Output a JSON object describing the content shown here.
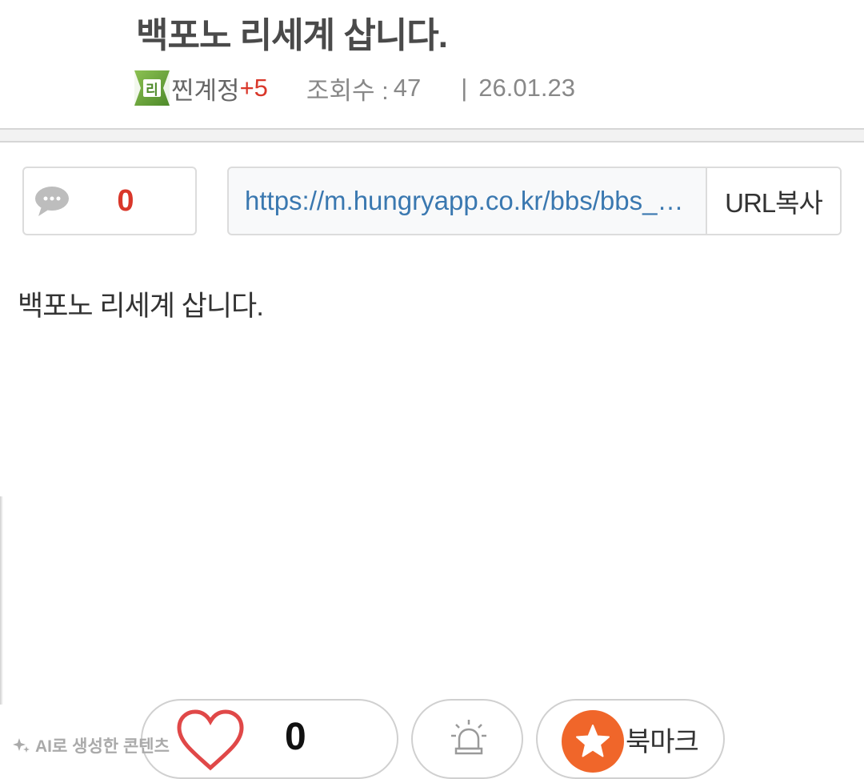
{
  "post": {
    "title": "백포노 리세계 삽니다.",
    "level_badge_text": "리",
    "author": "찐계정",
    "author_level": "+5",
    "views_label": "조회수 :",
    "views_value": "47",
    "date_separator": "|",
    "date": "26.01.23",
    "body": "백포노 리세계 삽니다."
  },
  "toolbar": {
    "comment_count": "0",
    "url": "https://m.hungryapp.co.kr/bbs/bbs_…",
    "url_copy_label": "URL복사"
  },
  "actions": {
    "like_count": "0",
    "bookmark_label": "북마크"
  },
  "watermark": {
    "text": "AI로 생성한 콘텐츠"
  },
  "icons": [
    "speech-bubble-icon",
    "heart-icon",
    "siren-icon",
    "star-icon",
    "sparkle-icon"
  ],
  "colors": {
    "accent_red": "#d9372a",
    "link_blue": "#3a78b0",
    "bookmark_orange": "#f0662a"
  }
}
